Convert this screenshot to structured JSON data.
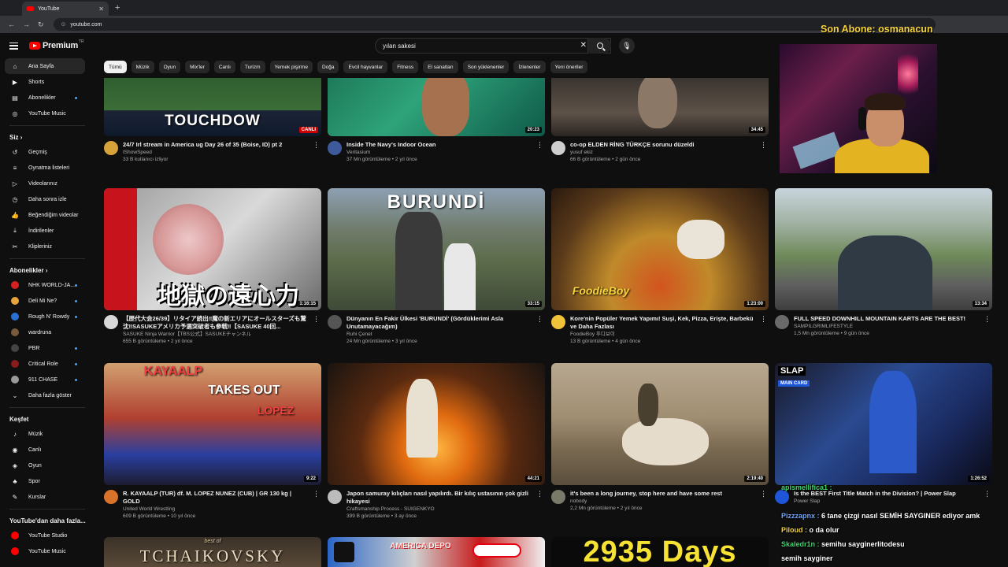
{
  "browser": {
    "tab_title": "YouTube",
    "url": "youtube.com"
  },
  "header": {
    "logo_text": "Premium",
    "logo_region": "TR",
    "search_value": "yılan sakesi"
  },
  "sidebar": {
    "main": [
      {
        "label": "Ana Sayfa",
        "icon": "home-icon"
      },
      {
        "label": "Shorts",
        "icon": "shorts-icon"
      },
      {
        "label": "Abonelikler",
        "icon": "subscriptions-icon"
      },
      {
        "label": "YouTube Music",
        "icon": "music-icon"
      }
    ],
    "you_title": "Siz",
    "you": [
      {
        "label": "Geçmiş",
        "icon": "history-icon"
      },
      {
        "label": "Oynatma listeleri",
        "icon": "playlist-icon"
      },
      {
        "label": "Videolarınız",
        "icon": "your-videos-icon"
      },
      {
        "label": "Daha sonra izle",
        "icon": "watch-later-icon"
      },
      {
        "label": "Beğendiğim videolar",
        "icon": "liked-icon"
      },
      {
        "label": "İndirilenler",
        "icon": "download-icon"
      },
      {
        "label": "Klipleriniz",
        "icon": "clips-icon"
      }
    ],
    "subs_title": "Abonelikler",
    "subs": [
      {
        "label": "NHK WORLD-JA...",
        "color": "#d92020"
      },
      {
        "label": "Deli Mi Ne?",
        "color": "#e7a33c"
      },
      {
        "label": "Rough N' Rowdy",
        "color": "#2a6fd3"
      },
      {
        "label": "wardruna",
        "color": "#7a5a3c"
      },
      {
        "label": "PBR",
        "color": "#444444"
      },
      {
        "label": "Critical Role",
        "color": "#8b1a1a"
      },
      {
        "label": "911 CHASE",
        "color": "#9a9a9a"
      }
    ],
    "more_label": "Daha fazla göster",
    "explore_title": "Keşfet",
    "explore": [
      {
        "label": "Müzik",
        "icon": "music-note-icon"
      },
      {
        "label": "Canlı",
        "icon": "live-icon"
      },
      {
        "label": "Oyun",
        "icon": "gaming-icon"
      },
      {
        "label": "Spor",
        "icon": "sports-icon"
      },
      {
        "label": "Kurslar",
        "icon": "courses-icon"
      }
    ],
    "more_yt_title": "YouTube'dan daha fazla...",
    "more_yt": [
      {
        "label": "YouTube Studio"
      },
      {
        "label": "YouTube Music"
      }
    ]
  },
  "chips": [
    "Tümü",
    "Müzik",
    "Oyun",
    "Mix'ler",
    "Canlı",
    "Turizm",
    "Yemek pişirme",
    "Doğa",
    "Evcil hayvanlar",
    "Fitness",
    "El sanatları",
    "Son yüklenenler",
    "İzlenenler",
    "Yeni öneriler"
  ],
  "videos_row1": [
    {
      "title": "24/7 Irl stream in America ug Day 26 of 35 (Boise, ID) pt 2",
      "channel": "IShowSpeed",
      "stats": "33 B kullanıcı izliyor",
      "thumb_text": "TOUCHDOW",
      "badge": "CANLI"
    },
    {
      "title": "Inside The Navy's Indoor Ocean",
      "channel": "Veritasium",
      "stats": "37 Mn görüntüleme • 2 yıl önce",
      "duration": "20:23"
    },
    {
      "title": "co-op ELDEN RİNG TÜRKÇE sorunu düzeldi",
      "channel": "yusuf ekiz",
      "stats": "66 B görüntüleme • 2 gün önce",
      "duration": "34:45"
    }
  ],
  "videos_row2": [
    {
      "title": "【歴代大会26/39】リタイア続出‼魔の新エリアにオールスターズも驚沈‼SASUKEアメリカ予選突破者も参戦‼【SASUKE 40回...",
      "channel": "SASUKE Ninja Warrior【TBS公式】SASUKEチャンネル",
      "stats": "655 B görüntüleme • 2 yıl önce",
      "duration": "1:16:15",
      "thumb_text": "地獄の遠心力"
    },
    {
      "title": "Dünyanın En Fakir Ülkesi 'BURUNDİ' (Gördüklerimi Asla Unutamayacağım)",
      "channel": "Ruhi Çenet",
      "stats": "24 Mn görüntüleme • 3 yıl önce",
      "duration": "33:15",
      "thumb_text": "BURUNDİ"
    },
    {
      "title": "Kore'nin Popüler Yemek Yapımı! Suşi, Kek, Pizza, Erişte, Barbekü ve Daha Fazlası",
      "channel": "FoodieBoy 푸디보이",
      "stats": "13 B görüntüleme • 4 gün önce",
      "duration": "1:23:00",
      "thumb_text": "FoodieBoy"
    },
    {
      "title": "FULL SPEED DOWNHILL MOUNTAIN KARTS ARE THE BEST!",
      "channel": "SAMPILGRIMLIFESTYLE",
      "stats": "1,5 Mn görüntüleme • 9 gün önce",
      "duration": "13:34"
    }
  ],
  "videos_row3": [
    {
      "title": "R. KAYAALP (TUR) df. M. LOPEZ NUNEZ (CUB) | GR 130 kg | GOLD",
      "channel": "United World Wrestling",
      "stats": "609 B görüntüleme • 10 yıl önce",
      "duration": "9:22",
      "thumb_text_1": "KAYAALP",
      "thumb_text_2": "TAKES OUT",
      "thumb_text_3": "LOPEZ"
    },
    {
      "title": "Japon samuray kılıçları nasıl yapılırdı. Bir kılıç ustasının çok gizli hikayesi",
      "channel": "Craftsmanship Process - SUIGENKYO",
      "stats": "399 B görüntüleme • 3 ay önce",
      "duration": "44:21"
    },
    {
      "title": "it's been a long journey, stop here and have some rest",
      "channel": "nobody",
      "stats": "2,2 Mn görüntüleme • 2 yıl önce",
      "duration": "2:19:40"
    },
    {
      "title": "Is the BEST First Title Match in the Division? | Power Slap",
      "channel": "Power Slap",
      "stats": "",
      "duration": "1:26:52",
      "thumb_text": "SLAP",
      "badge": "MAIN CARD"
    }
  ],
  "videos_row4": [
    {
      "thumb_small": "best of",
      "thumb_text": "TCHAIKOVSKY"
    },
    {
      "thumb_text": "AMERICA DEPO"
    },
    {
      "thumb_text": "2935 Days"
    }
  ],
  "stream_overlay": {
    "title": "Son Abone: osmanacun",
    "chat": [
      {
        "user": "apismellifica1 :",
        "msg": "",
        "color": "green"
      },
      {
        "user": "Pizzzapnx :",
        "msg": "6 tane çizgi nasıl SEMİH SAYGINER ediyor amk",
        "color": "blue"
      },
      {
        "user": "Piloud :",
        "msg": "o da olur",
        "color": "gold"
      },
      {
        "user": "Skaledr1n :",
        "msg": "semihu sayginerlitodesu",
        "color": "green"
      },
      {
        "user": "",
        "msg": "semih sayginer",
        "color": "green"
      }
    ]
  }
}
